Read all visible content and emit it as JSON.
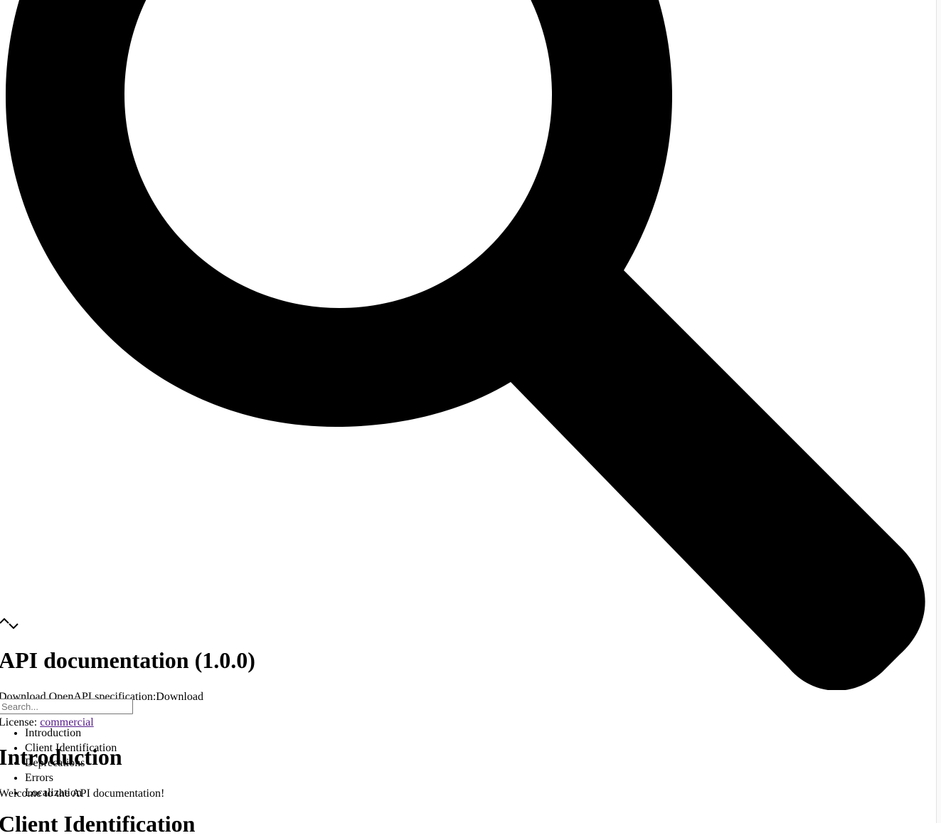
{
  "header": {
    "title": "API documentation (1.0.0)",
    "download_label": "Download OpenAPI specification:",
    "download_link": "Download"
  },
  "search": {
    "placeholder": "Search..."
  },
  "license": {
    "label": "License: ",
    "link": "commercial"
  },
  "nav": {
    "items": [
      {
        "label": "Introduction"
      },
      {
        "label": "Client Identification"
      },
      {
        "label": "Deprecations"
      },
      {
        "label": "Errors"
      },
      {
        "label": "Localization"
      }
    ]
  },
  "content": {
    "intro_heading": "Introduction",
    "welcome_text": "Welcome to the API documentation!",
    "client_heading": "Client Identification"
  },
  "icons": {
    "search": "search-icon",
    "chevron_up": "chevron-up-icon",
    "chevron_down": "chevron-down-icon"
  }
}
